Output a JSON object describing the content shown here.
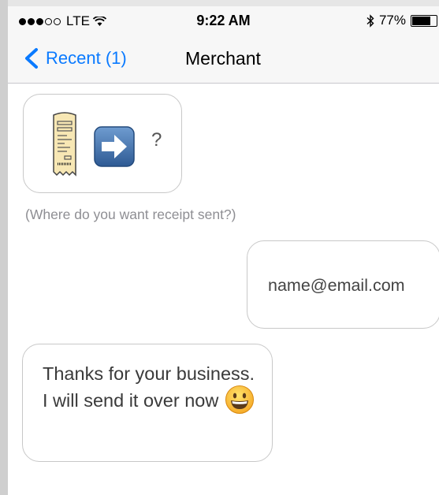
{
  "status_bar": {
    "signal_dots_filled": 3,
    "signal_dots_total": 5,
    "carrier": "LTE",
    "wifi_icon": "wifi-icon",
    "time": "9:22 AM",
    "bluetooth_icon": "bluetooth-icon",
    "battery_percent": "77%",
    "battery_level": 0.77
  },
  "nav": {
    "back_label": "Recent (1)",
    "title": "Merchant"
  },
  "messages": {
    "icon_message": {
      "icons": [
        "receipt-icon",
        "right-arrow-icon"
      ],
      "question_mark": "?"
    },
    "caption": "(Where do you want receipt sent?)",
    "email_reply": "name@email.com",
    "thanks_message": "Thanks for your business. I will send it over now",
    "thanks_emoji": "grinning-face-icon"
  },
  "colors": {
    "accent": "#0a7aff",
    "bar_background": "#f7f7f7",
    "bubble_border": "#c8c8c8",
    "caption": "#8e8e93"
  }
}
